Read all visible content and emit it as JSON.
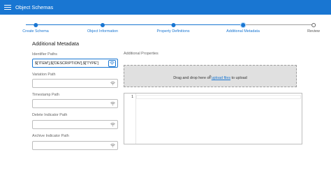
{
  "appbar": {
    "title": "Object Schemas",
    "menu_icon": "menu-icon",
    "background": "#1976d2"
  },
  "stepper": {
    "accent": "#1976d2",
    "steps": [
      {
        "label": "Create Schema",
        "state": "done"
      },
      {
        "label": "Object Information",
        "state": "done"
      },
      {
        "label": "Property Definitions",
        "state": "done"
      },
      {
        "label": "Additional Metadata",
        "state": "active"
      },
      {
        "label": "Review",
        "state": "todo"
      }
    ]
  },
  "form": {
    "title": "Additional Metadata",
    "fields": [
      {
        "label": "Identifier Paths",
        "value": "$['ITEM'],$['DESCRIPTION'],$['TYPE']",
        "icon": "variable-picker-icon",
        "focused": true
      },
      {
        "label": "Variation Path",
        "value": "",
        "icon": "variable-picker-icon",
        "focused": false
      },
      {
        "label": "Timestamp Path",
        "value": "",
        "icon": "variable-picker-icon",
        "focused": false
      },
      {
        "label": "Delete Indicator Path",
        "value": "",
        "icon": "variable-picker-icon",
        "focused": false
      },
      {
        "label": "Archive Indicator Path",
        "value": "",
        "icon": "variable-picker-icon",
        "focused": false
      }
    ]
  },
  "additional_properties": {
    "label": "Additional Properties",
    "dropzone": {
      "icon": "upload-icon",
      "text_before": "Drag and drop here or ",
      "link": "upload files",
      "text_after": " to upload"
    },
    "editor": {
      "line_number": "1",
      "content": ""
    }
  }
}
